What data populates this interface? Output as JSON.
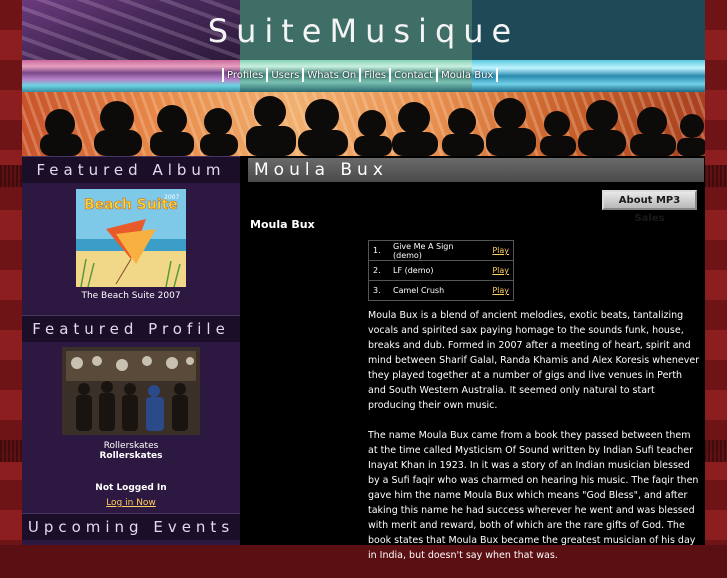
{
  "site": {
    "title": "SuiteMusique"
  },
  "nav": {
    "items": [
      "Profiles",
      "Users",
      "Whats On",
      "Files",
      "Contact",
      "Moula Bux"
    ]
  },
  "sidebar": {
    "featured_album": {
      "heading": "Featured Album",
      "caption": "The Beach Suite 2007",
      "cover_title": "Beach Suite",
      "cover_year": "2007"
    },
    "featured_profile": {
      "heading": "Featured Profile",
      "name_line1": "Rollerskates",
      "name_line2": "Rollerskates"
    },
    "login": {
      "status": "Not Logged In",
      "link": "Log in Now"
    },
    "upcoming_events": {
      "heading": "Upcoming Events"
    }
  },
  "main": {
    "heading": "Moula Bux",
    "mp3_button": "About MP3 Sales",
    "artist_name": "Moula Bux",
    "tracks": [
      {
        "num": "1.",
        "title": "Give Me A Sign (demo)",
        "action": "Play"
      },
      {
        "num": "2.",
        "title": "LF (demo)",
        "action": "Play"
      },
      {
        "num": "3.",
        "title": "Camel Crush",
        "action": "Play"
      }
    ],
    "bio": [
      "Moula Bux is a blend of ancient melodies, exotic beats, tantalizing vocals and spirited sax paying homage to the sounds funk, house, breaks and dub. Formed in 2007 after a meeting of heart, spirit and mind between Sharif Galal, Randa Khamis and Alex Koresis whenever they played together at a number of gigs and live venues in Perth and South Western Australia. It seemed only natural to start producing their own music.",
      "The name Moula Bux came from a book they passed between them at the time called Mysticism Of Sound written by Indian Sufi teacher Inayat Khan in 1923. In it was a story of an Indian musician blessed by a Sufi faqir who was charmed on hearing his music. The faqir then gave him the name Moula Bux which means \"God Bless\", and after taking this name he had success wherever he went and was blessed with merit and reward, both of which are the rare gifts of God. The book states that Moula Bux became the greatest musician of his day in India, but doesn't say when that was."
    ]
  }
}
